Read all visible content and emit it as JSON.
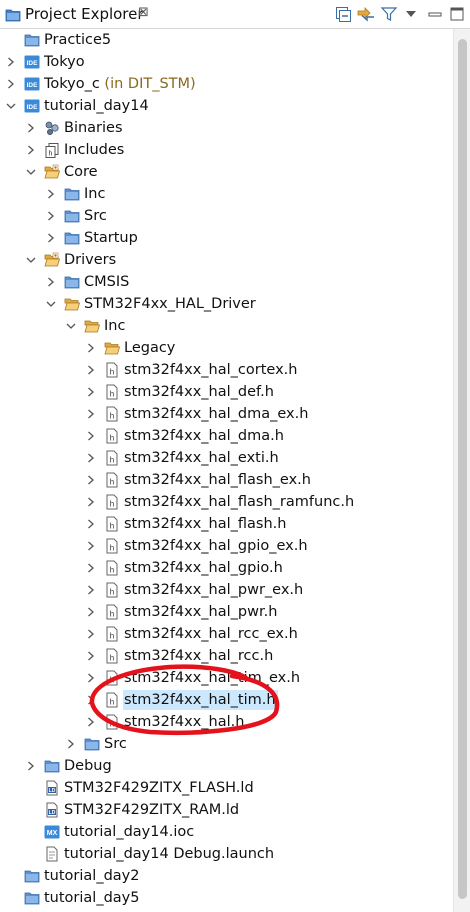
{
  "view": {
    "title": "Project Explorer",
    "close_glyph": "⊠",
    "toolbar": [
      {
        "name": "collapse-all-button",
        "icon": "collapse-all-icon"
      },
      {
        "name": "link-with-editor-button",
        "icon": "link-with-editor-icon"
      },
      {
        "name": "filter-button",
        "icon": "filter-icon"
      },
      {
        "name": "view-menu-button",
        "icon": "view-menu-icon"
      }
    ]
  },
  "tree": [
    {
      "depth": 0,
      "twisty": "none",
      "icon": "folder-closed-icon",
      "label": "Practice5"
    },
    {
      "depth": 0,
      "twisty": "collapsed",
      "icon": "ide-project-icon",
      "label": "Tokyo"
    },
    {
      "depth": 0,
      "twisty": "collapsed",
      "icon": "ide-project-icon",
      "label": "Tokyo_c",
      "suffix": " (in DIT_STM)"
    },
    {
      "depth": 0,
      "twisty": "expanded",
      "icon": "ide-project-icon",
      "label": "tutorial_day14"
    },
    {
      "depth": 1,
      "twisty": "collapsed",
      "icon": "binaries-icon",
      "label": "Binaries"
    },
    {
      "depth": 1,
      "twisty": "collapsed",
      "icon": "includes-icon",
      "label": "Includes"
    },
    {
      "depth": 1,
      "twisty": "expanded",
      "icon": "source-folder-open-icon",
      "label": "Core"
    },
    {
      "depth": 2,
      "twisty": "collapsed",
      "icon": "folder-closed-icon",
      "label": "Inc"
    },
    {
      "depth": 2,
      "twisty": "collapsed",
      "icon": "folder-closed-icon",
      "label": "Src"
    },
    {
      "depth": 2,
      "twisty": "collapsed",
      "icon": "folder-closed-icon",
      "label": "Startup"
    },
    {
      "depth": 1,
      "twisty": "expanded",
      "icon": "source-folder-open-icon",
      "label": "Drivers"
    },
    {
      "depth": 2,
      "twisty": "collapsed",
      "icon": "folder-closed-icon",
      "label": "CMSIS"
    },
    {
      "depth": 2,
      "twisty": "expanded",
      "icon": "folder-open-icon",
      "label": "STM32F4xx_HAL_Driver"
    },
    {
      "depth": 3,
      "twisty": "expanded",
      "icon": "folder-open-icon",
      "label": "Inc"
    },
    {
      "depth": 4,
      "twisty": "collapsed",
      "icon": "folder-open-icon",
      "label": "Legacy"
    },
    {
      "depth": 4,
      "twisty": "collapsed",
      "icon": "header-file-icon",
      "label": "stm32f4xx_hal_cortex.h"
    },
    {
      "depth": 4,
      "twisty": "collapsed",
      "icon": "header-file-icon",
      "label": "stm32f4xx_hal_def.h"
    },
    {
      "depth": 4,
      "twisty": "collapsed",
      "icon": "header-file-icon",
      "label": "stm32f4xx_hal_dma_ex.h"
    },
    {
      "depth": 4,
      "twisty": "collapsed",
      "icon": "header-file-icon",
      "label": "stm32f4xx_hal_dma.h"
    },
    {
      "depth": 4,
      "twisty": "collapsed",
      "icon": "header-file-icon",
      "label": "stm32f4xx_hal_exti.h"
    },
    {
      "depth": 4,
      "twisty": "collapsed",
      "icon": "header-file-icon",
      "label": "stm32f4xx_hal_flash_ex.h"
    },
    {
      "depth": 4,
      "twisty": "collapsed",
      "icon": "header-file-icon",
      "label": "stm32f4xx_hal_flash_ramfunc.h"
    },
    {
      "depth": 4,
      "twisty": "collapsed",
      "icon": "header-file-icon",
      "label": "stm32f4xx_hal_flash.h"
    },
    {
      "depth": 4,
      "twisty": "collapsed",
      "icon": "header-file-icon",
      "label": "stm32f4xx_hal_gpio_ex.h"
    },
    {
      "depth": 4,
      "twisty": "collapsed",
      "icon": "header-file-icon",
      "label": "stm32f4xx_hal_gpio.h"
    },
    {
      "depth": 4,
      "twisty": "collapsed",
      "icon": "header-file-icon",
      "label": "stm32f4xx_hal_pwr_ex.h"
    },
    {
      "depth": 4,
      "twisty": "collapsed",
      "icon": "header-file-icon",
      "label": "stm32f4xx_hal_pwr.h"
    },
    {
      "depth": 4,
      "twisty": "collapsed",
      "icon": "header-file-icon",
      "label": "stm32f4xx_hal_rcc_ex.h"
    },
    {
      "depth": 4,
      "twisty": "collapsed",
      "icon": "header-file-icon",
      "label": "stm32f4xx_hal_rcc.h"
    },
    {
      "depth": 4,
      "twisty": "collapsed",
      "icon": "header-file-icon",
      "label": "stm32f4xx_hal_tim_ex.h"
    },
    {
      "depth": 4,
      "twisty": "collapsed",
      "icon": "header-file-icon",
      "label": "stm32f4xx_hal_tim.h",
      "selected": true
    },
    {
      "depth": 4,
      "twisty": "collapsed",
      "icon": "header-file-icon",
      "label": "stm32f4xx_hal.h"
    },
    {
      "depth": 3,
      "twisty": "collapsed",
      "icon": "folder-closed-icon",
      "label": "Src"
    },
    {
      "depth": 1,
      "twisty": "collapsed",
      "icon": "folder-closed-icon",
      "label": "Debug"
    },
    {
      "depth": 1,
      "twisty": "none",
      "icon": "ld-file-icon",
      "label": "STM32F429ZITX_FLASH.ld"
    },
    {
      "depth": 1,
      "twisty": "none",
      "icon": "ld-file-icon",
      "label": "STM32F429ZITX_RAM.ld"
    },
    {
      "depth": 1,
      "twisty": "none",
      "icon": "mx-file-icon",
      "label": "tutorial_day14.ioc"
    },
    {
      "depth": 1,
      "twisty": "none",
      "icon": "launch-file-icon",
      "label": "tutorial_day14 Debug.launch"
    },
    {
      "depth": 0,
      "twisty": "none",
      "icon": "folder-closed-icon",
      "label": "tutorial_day2"
    },
    {
      "depth": 0,
      "twisty": "none",
      "icon": "folder-closed-icon",
      "label": "tutorial_day5"
    }
  ],
  "annotation": {
    "color": "#e3121b"
  }
}
